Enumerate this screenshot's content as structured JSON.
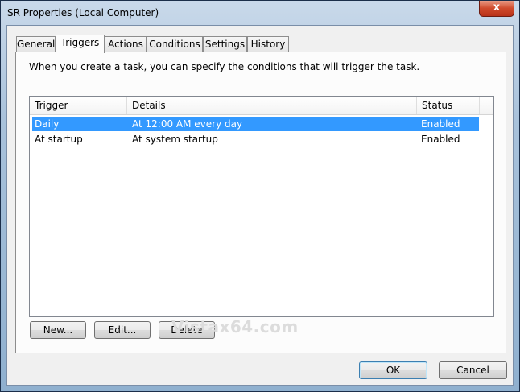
{
  "window": {
    "title": "SR Properties (Local Computer)",
    "close_glyph": "x"
  },
  "tabs": [
    {
      "label": "General"
    },
    {
      "label": "Triggers",
      "active": true
    },
    {
      "label": "Actions"
    },
    {
      "label": "Conditions"
    },
    {
      "label": "Settings"
    },
    {
      "label": "History"
    }
  ],
  "description": "When you create a task, you can specify the conditions that will trigger the task.",
  "list": {
    "columns": [
      "Trigger",
      "Details",
      "Status"
    ],
    "rows": [
      {
        "trigger": "Daily",
        "details": "At 12:00 AM every day",
        "status": "Enabled",
        "selected": true
      },
      {
        "trigger": "At startup",
        "details": "At system startup",
        "status": "Enabled",
        "selected": false
      }
    ]
  },
  "buttons": {
    "new": "New...",
    "edit": "Edit...",
    "delete": "Delete",
    "ok": "OK",
    "cancel": "Cancel"
  },
  "watermark": "Vistax64.com",
  "colors": {
    "selection": "#3399ff",
    "close_button": "#cf4a2c"
  }
}
